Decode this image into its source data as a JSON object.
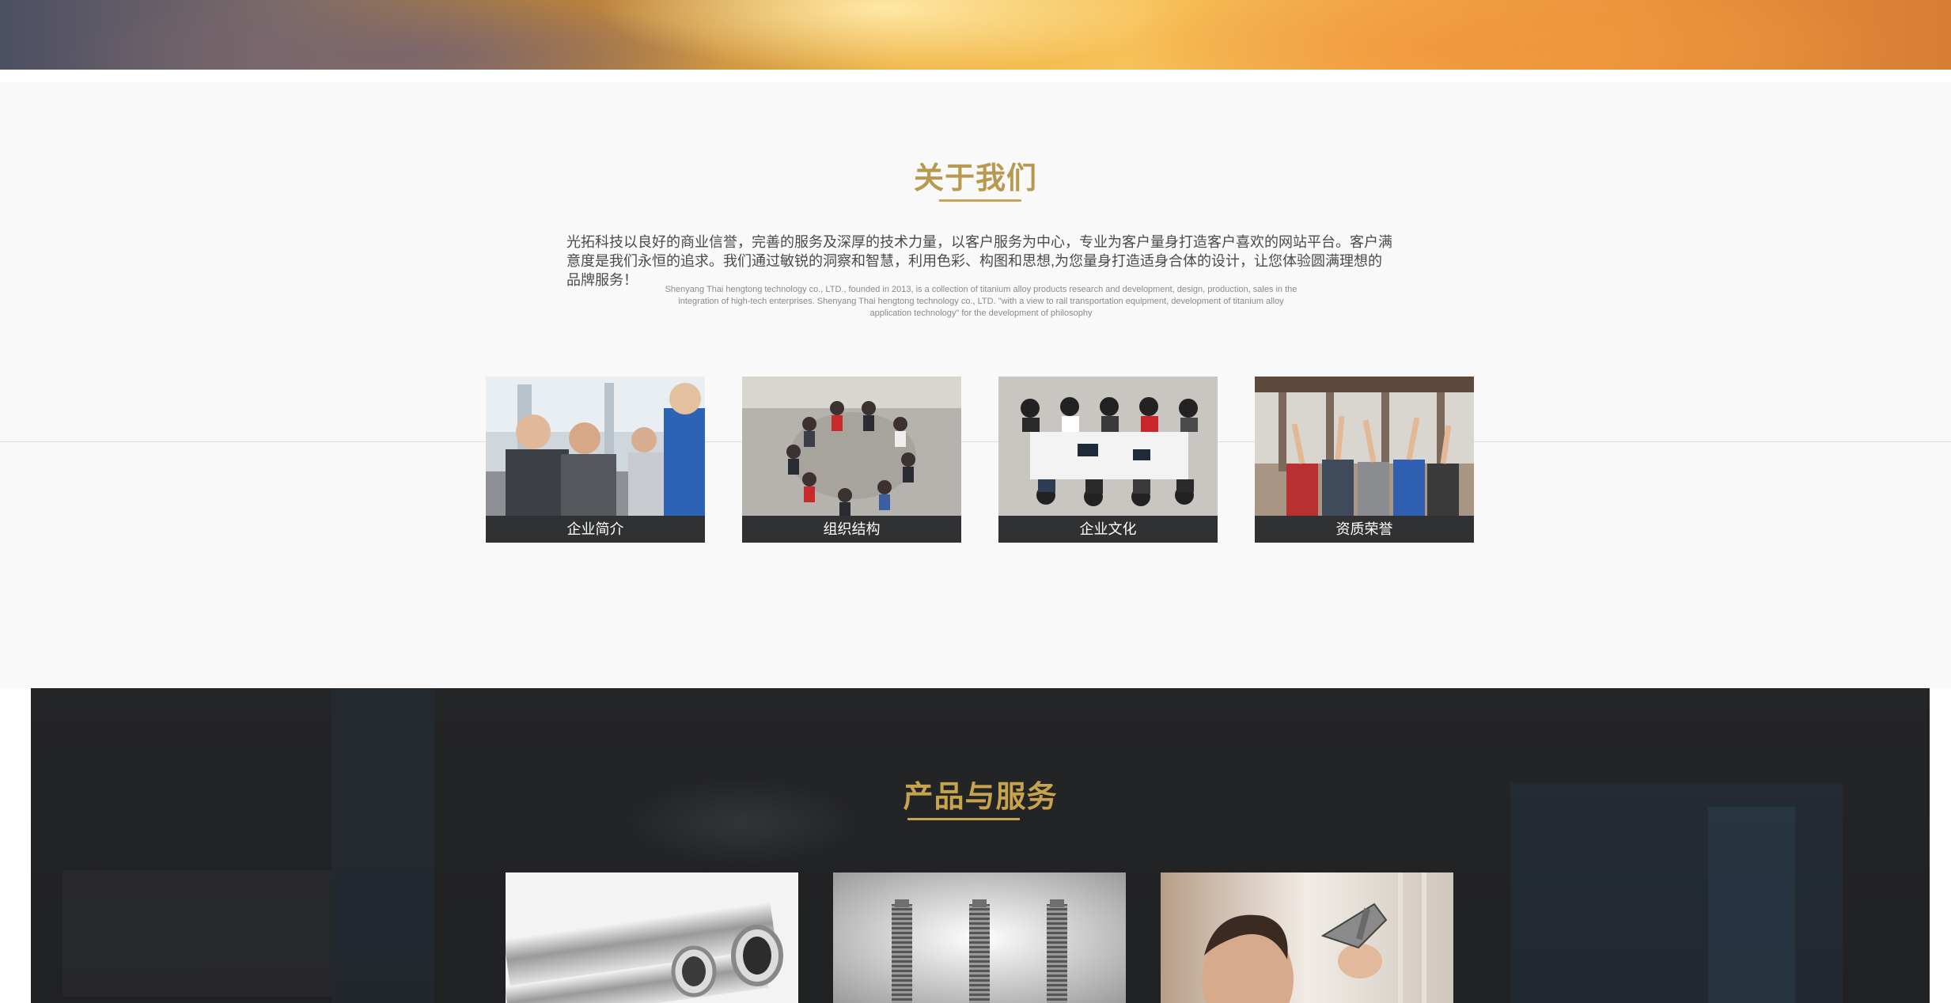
{
  "about": {
    "title": "关于我们",
    "intro": "光拓科技以良好的商业信誉，完善的服务及深厚的技术力量，以客户服务为中心，专业为客户量身打造客户喜欢的网站平台。客户满意度是我们永恒的追求。我们通过敏锐的洞察和智慧，利用色彩、构图和思想,为您量身打造适身合体的设计，让您体验圆满理想的品牌服务！",
    "english": "Shenyang Thai hengtong technology co., LTD., founded in 2013, is a collection of titanium alloy products research and development, design, production, sales in the integration of high-tech enterprises. Shenyang Thai hengtong technology co., LTD. \"with a view to rail transportation equipment, development of titanium alloy application technology\" for the development of philosophy",
    "cards": [
      {
        "label": "企业简介",
        "image": "business-meeting-photo"
      },
      {
        "label": "组织结构",
        "image": "team-circle-photo"
      },
      {
        "label": "企业文化",
        "image": "conference-table-photo"
      },
      {
        "label": "资质荣誉",
        "image": "team-celebration-photo"
      }
    ]
  },
  "products": {
    "title": "产品与服务",
    "items": [
      {
        "image": "steel-pipes-photo"
      },
      {
        "image": "threaded-rods-photo"
      },
      {
        "image": "engineer-inspecting-part-photo"
      }
    ]
  },
  "colors": {
    "accent_gold": "#c6a45a",
    "caption_bar": "#303133",
    "dark_section": "#222325"
  }
}
